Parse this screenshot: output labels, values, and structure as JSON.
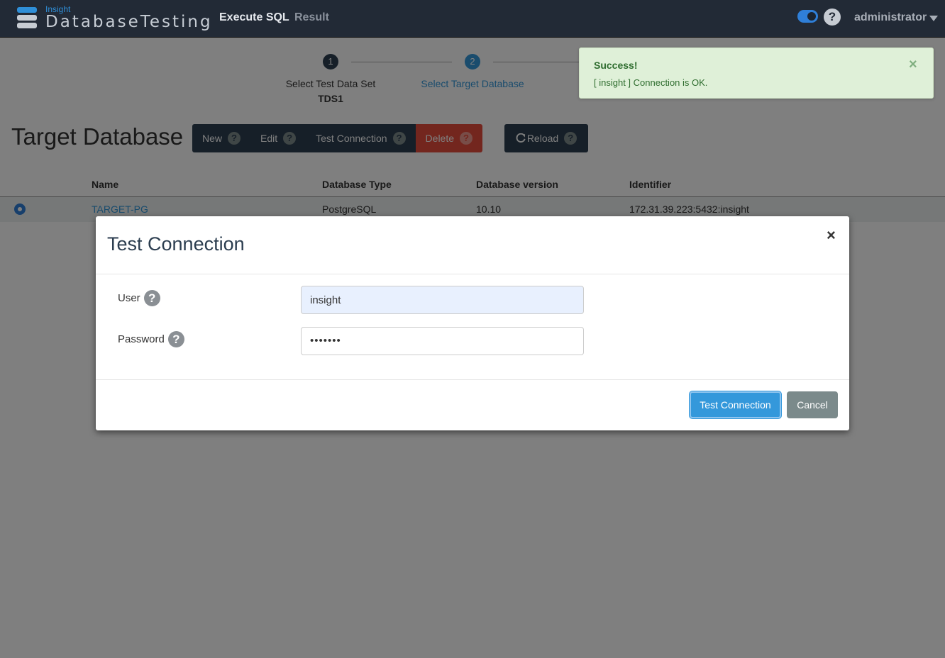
{
  "app": {
    "logo_small": "Insight",
    "logo_big": "DatabaseTesting",
    "nav": [
      {
        "label": "Execute SQL",
        "active": true
      },
      {
        "label": "Result",
        "active": false
      }
    ],
    "help_icon_glyph": "?",
    "user": "administrator",
    "toggle_on": true
  },
  "stepper": {
    "steps": [
      {
        "number": "1",
        "label": "Select Test Data Set",
        "value": "TDS1",
        "state": "done"
      },
      {
        "number": "2",
        "label": "Select Target Database",
        "value": "",
        "state": "current"
      }
    ]
  },
  "page": {
    "title": "Target Database"
  },
  "toolbar": {
    "buttons": [
      {
        "label": "New",
        "help": "?"
      },
      {
        "label": "Edit",
        "help": "?"
      },
      {
        "label": "Test Connection",
        "help": "?"
      },
      {
        "label": "Delete",
        "help": "?"
      }
    ],
    "reload": {
      "icon": "refresh-icon",
      "label": "Reload",
      "help": "?"
    }
  },
  "table": {
    "columns": [
      "Name",
      "Database Type",
      "Database version",
      "Identifier"
    ],
    "rows": [
      {
        "name": "TARGET-PG",
        "type": "PostgreSQL",
        "version": "10.10",
        "identifier": "172.31.39.223:5432:insight",
        "selected": true
      }
    ]
  },
  "modal": {
    "title": "Test Connection",
    "close_glyph": "×",
    "user_label": "User",
    "user_value": "insight",
    "password_label": "Password",
    "password_value": "•••••••",
    "help_glyph": "?",
    "submit_label": "Test Connection",
    "cancel_label": "Cancel"
  },
  "toast": {
    "title": "Success!",
    "message": "[ insight ] Connection is OK.",
    "close_glyph": "×",
    "color": "#dff0d8"
  },
  "colors": {
    "topbar": "#222a36",
    "primary": "#3498db",
    "danger": "#e74c3c",
    "dark_button": "#2c3e50"
  }
}
